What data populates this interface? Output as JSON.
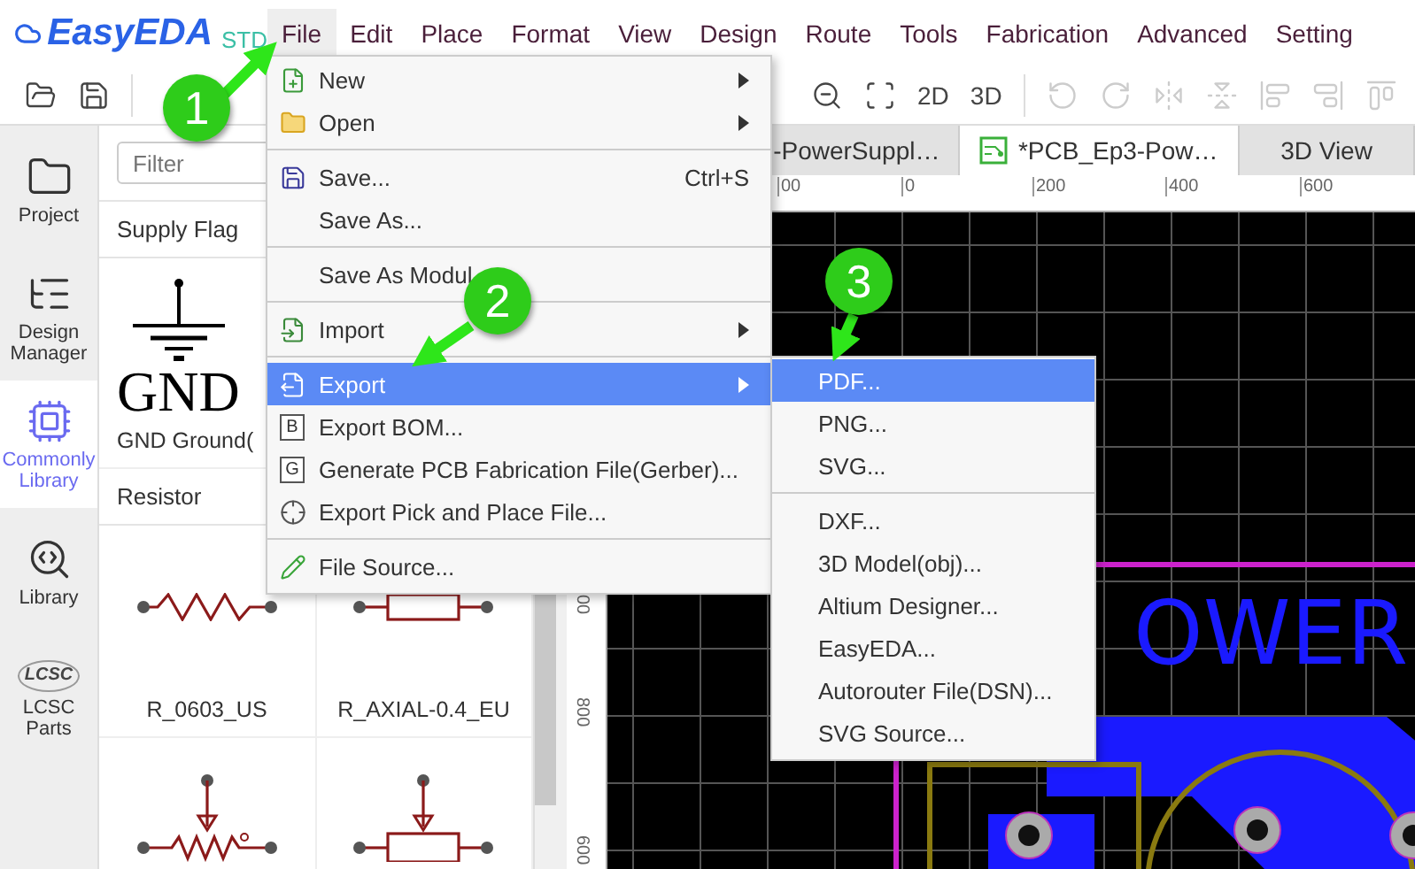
{
  "app": {
    "logo": "EasyEDA",
    "edition": "STD"
  },
  "menubar": [
    {
      "label": "File",
      "selected": true
    },
    {
      "label": "Edit",
      "selected": false
    },
    {
      "label": "Place",
      "selected": false
    },
    {
      "label": "Format",
      "selected": false
    },
    {
      "label": "View",
      "selected": false
    },
    {
      "label": "Design",
      "selected": false
    },
    {
      "label": "Route",
      "selected": false
    },
    {
      "label": "Tools",
      "selected": false
    },
    {
      "label": "Fabrication",
      "selected": false
    },
    {
      "label": "Advanced",
      "selected": false
    },
    {
      "label": "Setting",
      "selected": false
    }
  ],
  "toolbar_left": [
    {
      "kind": "open",
      "disabled": false
    },
    {
      "kind": "save",
      "disabled": false
    }
  ],
  "toolbar_right": [
    {
      "kind": "zoom-out",
      "disabled": false
    },
    {
      "kind": "fit",
      "disabled": false
    },
    {
      "kind": "text",
      "label": "2D",
      "disabled": false
    },
    {
      "kind": "text",
      "label": "3D",
      "disabled": false
    },
    {
      "kind": "separator"
    },
    {
      "kind": "rotate-left",
      "disabled": true
    },
    {
      "kind": "rotate-right",
      "disabled": true
    },
    {
      "kind": "flip-horizontal",
      "disabled": true
    },
    {
      "kind": "flip-vertical",
      "disabled": true
    },
    {
      "kind": "align-left",
      "disabled": true
    },
    {
      "kind": "align-right",
      "disabled": true
    },
    {
      "kind": "align-top",
      "disabled": true
    }
  ],
  "rail": [
    {
      "kind": "project",
      "label": "Project",
      "selected": false
    },
    {
      "kind": "design-manager",
      "label": "Design Manager",
      "selected": false
    },
    {
      "kind": "common-library",
      "label": "Commonly Library",
      "selected": true
    },
    {
      "kind": "library",
      "label": "Library",
      "selected": false
    },
    {
      "kind": "lcsc",
      "label": "LCSC Parts",
      "logo_text": "LCSC",
      "selected": false
    }
  ],
  "library": {
    "filter": {
      "placeholder": "Filter"
    },
    "sections": [
      {
        "title": "Supply Flag",
        "parts": [
          {
            "kind": "ground",
            "symbol_text": "GND",
            "name": "GND Ground("
          }
        ]
      },
      {
        "title": "Resistor",
        "parts": [
          {
            "kind": "resistor",
            "name": "R_0603_US"
          },
          {
            "kind": "resistor",
            "name": "R_AXIAL-0.4_EU"
          },
          {
            "kind": "potentiometer"
          },
          {
            "kind": "potentiometer"
          }
        ]
      }
    ]
  },
  "tabs": [
    {
      "kind": "schematic",
      "label": "-PowerSuppl…",
      "selected": false
    },
    {
      "kind": "pcb",
      "label": "*PCB_Ep3-Pow…",
      "selected": true
    },
    {
      "kind": "plain",
      "label": "3D View",
      "selected": false
    }
  ],
  "ruler": {
    "horizontal": [
      "00",
      "0",
      "200",
      "400",
      "600"
    ],
    "vertical": [
      "00",
      "800",
      "600"
    ]
  },
  "pcb": {
    "silkscreen_text": "OWER"
  },
  "file_menu": [
    {
      "kind": "item",
      "label": "New",
      "submenu": true,
      "selected": false
    },
    {
      "kind": "item",
      "label": "Open",
      "submenu": true,
      "selected": false
    },
    {
      "kind": "separator"
    },
    {
      "kind": "item",
      "label": "Save...",
      "shortcut": "Ctrl+S",
      "selected": false
    },
    {
      "kind": "item",
      "label": "Save As...",
      "selected": false
    },
    {
      "kind": "separator"
    },
    {
      "kind": "item",
      "label": "Save As Modul",
      "selected": false
    },
    {
      "kind": "separator"
    },
    {
      "kind": "item",
      "label": "Import",
      "submenu": true,
      "selected": false
    },
    {
      "kind": "separator"
    },
    {
      "kind": "item",
      "label": "Export",
      "submenu": true,
      "selected": true
    },
    {
      "kind": "item",
      "icon_text": "B",
      "label": "Export BOM...",
      "selected": false
    },
    {
      "kind": "item",
      "icon_text": "G",
      "label": "Generate PCB Fabrication File(Gerber)...",
      "selected": false
    },
    {
      "kind": "item",
      "label": "Export Pick and Place File...",
      "selected": false
    },
    {
      "kind": "separator"
    },
    {
      "kind": "item",
      "label": "File Source...",
      "selected": false
    }
  ],
  "export_menu": [
    {
      "kind": "item",
      "label": "PDF...",
      "selected": true
    },
    {
      "kind": "item",
      "label": "PNG...",
      "selected": false
    },
    {
      "kind": "item",
      "label": "SVG...",
      "selected": false
    },
    {
      "kind": "separator"
    },
    {
      "kind": "item",
      "label": "DXF...",
      "selected": false
    },
    {
      "kind": "item",
      "label": "3D Model(obj)...",
      "selected": false
    },
    {
      "kind": "item",
      "label": "Altium Designer...",
      "selected": false
    },
    {
      "kind": "item",
      "label": "EasyEDA...",
      "selected": false
    },
    {
      "kind": "item",
      "label": "Autorouter File(DSN)...",
      "selected": false
    },
    {
      "kind": "item",
      "label": "SVG Source...",
      "selected": false
    }
  ],
  "callouts": [
    {
      "number": "1"
    },
    {
      "number": "2"
    },
    {
      "number": "3"
    }
  ]
}
